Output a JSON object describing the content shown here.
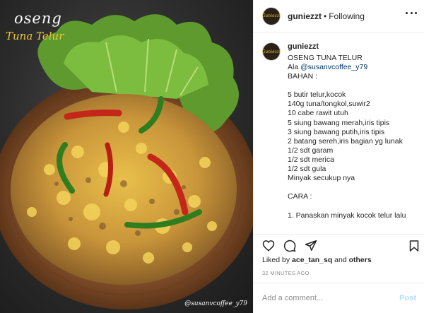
{
  "photo": {
    "title": "oseng",
    "subtitle": "Tuna Telur",
    "watermark": "@susanvcoffee_y79"
  },
  "header": {
    "avatar_text": "Guniezzt",
    "username": "guniezzt",
    "separator": "•",
    "follow_status": "Following"
  },
  "post": {
    "username": "guniezzt",
    "caption_lines": [
      "OSENG TUNA TELUR",
      "Ala ",
      "BAHAN :",
      "",
      "5 butir telur,kocok",
      "140g tuna/tongkol,suwir2",
      "10 cabe rawit utuh",
      "5 siung bawang merah,iris tipis",
      "3 siung bawang putih,iris tipis",
      "2 batang sereh,iris bagian yg lunak",
      "1/2 sdt garam",
      "1/2 sdt merica",
      "1/2 sdt gula",
      "Minyak secukup nya",
      "",
      "CARA :",
      "",
      "1. Panaskan minyak kocok telur lalu"
    ],
    "mention": "@susanvcoffee_y79"
  },
  "likes": {
    "prefix": "Liked by ",
    "user": "ace_tan_sq",
    "middle": " and ",
    "others": "others"
  },
  "timestamp": "32 MINUTES AGO",
  "comment": {
    "placeholder": "Add a comment...",
    "post_label": "Post"
  },
  "colors": {
    "mention": "#00376b",
    "post_disabled": "#b2dffc",
    "subtitle_gold": "#f0c531"
  }
}
